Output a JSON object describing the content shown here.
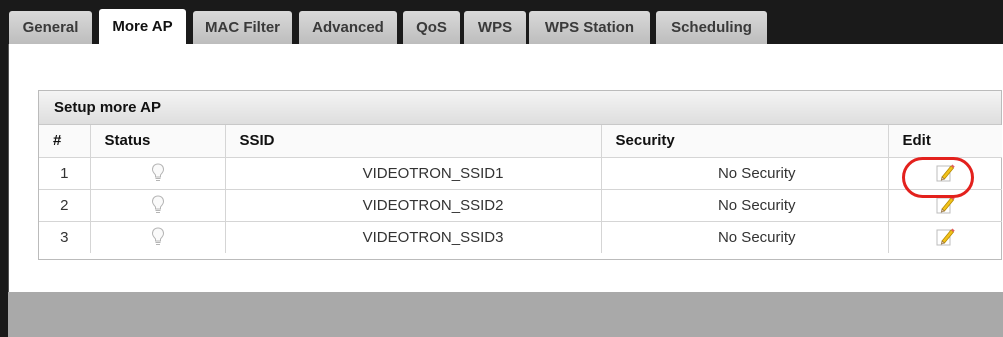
{
  "tabs": [
    {
      "label": "General",
      "active": false
    },
    {
      "label": "More AP",
      "active": true
    },
    {
      "label": "MAC Filter",
      "active": false
    },
    {
      "label": "Advanced",
      "active": false
    },
    {
      "label": "QoS",
      "active": false
    },
    {
      "label": "WPS",
      "active": false
    },
    {
      "label": "WPS Station",
      "active": false
    },
    {
      "label": "Scheduling",
      "active": false
    }
  ],
  "section": {
    "title": "Setup more AP",
    "columns": [
      "#",
      "Status",
      "SSID",
      "Security",
      "Edit"
    ],
    "rows": [
      {
        "num": "1",
        "status_icon": "lightbulb-off-icon",
        "ssid": "VIDEOTRON_SSID1",
        "security": "No Security",
        "edit_icon": "edit-pencil-icon"
      },
      {
        "num": "2",
        "status_icon": "lightbulb-off-icon",
        "ssid": "VIDEOTRON_SSID2",
        "security": "No Security",
        "edit_icon": "edit-pencil-icon"
      },
      {
        "num": "3",
        "status_icon": "lightbulb-off-icon",
        "ssid": "VIDEOTRON_SSID3",
        "security": "No Security",
        "edit_icon": "edit-pencil-icon"
      }
    ]
  },
  "colors": {
    "tabbar_bg": "#1a1a1a",
    "callout": "#e3211d",
    "bottom_band": "#a9a9a9"
  }
}
